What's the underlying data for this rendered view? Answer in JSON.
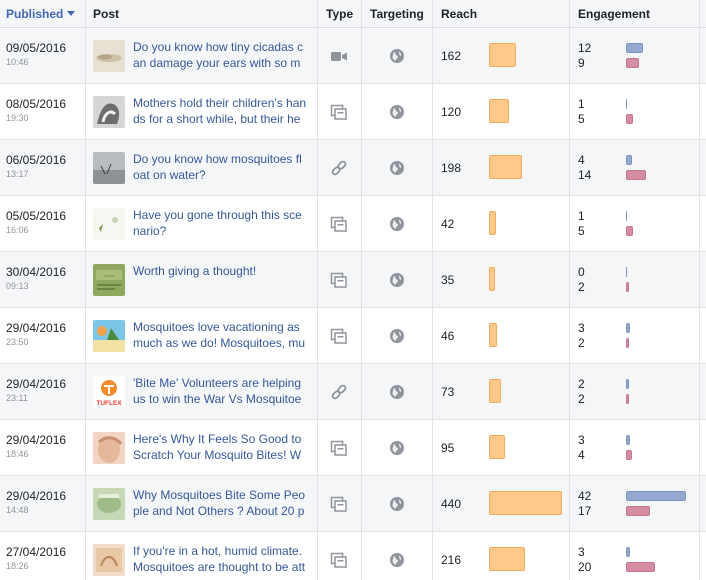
{
  "header": {
    "published": "Published",
    "post": "Post",
    "type": "Type",
    "targeting": "Targeting",
    "reach": "Reach",
    "engagement": "Engagement"
  },
  "colors": {
    "reach_bar": "#ffc98b",
    "engagement_clicks": "#97a8d1",
    "engagement_reactions": "#d58da1",
    "link": "#365899",
    "sorted_header": "#4267b2"
  },
  "rows": [
    {
      "date": "09/05/2016",
      "time": "10:46",
      "post": "Do you know how tiny cicadas can damage your ears with so mu",
      "type_icon": "video-icon",
      "targeting_icon": "globe-icon",
      "reach": "162",
      "eng_top": "12",
      "eng_bottom": "9",
      "thumb": "cicada"
    },
    {
      "date": "08/05/2016",
      "time": "19:30",
      "post": "Mothers hold their children's hands for a short while, but their hea",
      "type_icon": "status-icon",
      "targeting_icon": "globe-icon",
      "reach": "120",
      "eng_top": "1",
      "eng_bottom": "5",
      "thumb": "hands"
    },
    {
      "date": "06/05/2016",
      "time": "13:17",
      "post": "Do you know how mosquitoes float on water?",
      "type_icon": "link-icon",
      "targeting_icon": "globe-icon",
      "reach": "198",
      "eng_top": "4",
      "eng_bottom": "14",
      "thumb": "water"
    },
    {
      "date": "05/05/2016",
      "time": "16:06",
      "post": "Have you gone through this scenario?",
      "type_icon": "status-icon",
      "targeting_icon": "globe-icon",
      "reach": "42",
      "eng_top": "1",
      "eng_bottom": "5",
      "thumb": "scenario"
    },
    {
      "date": "30/04/2016",
      "time": "09:13",
      "post": "Worth giving a thought!",
      "type_icon": "status-icon",
      "targeting_icon": "globe-icon",
      "reach": "35",
      "eng_top": "0",
      "eng_bottom": "2",
      "thumb": "thought"
    },
    {
      "date": "29/04/2016",
      "time": "23:50",
      "post": "Mosquitoes love vacationing as much as we do! Mosquitoes, mu",
      "type_icon": "status-icon",
      "targeting_icon": "globe-icon",
      "reach": "46",
      "eng_top": "3",
      "eng_bottom": "2",
      "thumb": "vacation"
    },
    {
      "date": "29/04/2016",
      "time": "23:11",
      "post": "'Bite Me' Volunteers are helping us to win the War Vs Mosquitoes",
      "type_icon": "link-icon",
      "targeting_icon": "globe-icon",
      "reach": "73",
      "eng_top": "2",
      "eng_bottom": "2",
      "thumb": "tuflex",
      "thumb_label": "TUFLEX"
    },
    {
      "date": "29/04/2016",
      "time": "18:46",
      "post": "Here's Why It Feels So Good to Scratch Your Mosquito Bites! We",
      "type_icon": "status-icon",
      "targeting_icon": "globe-icon",
      "reach": "95",
      "eng_top": "3",
      "eng_bottom": "4",
      "thumb": "scratch"
    },
    {
      "date": "29/04/2016",
      "time": "14:48",
      "post": "Why Mosquitoes Bite Some People and Not Others ? About 20 p",
      "type_icon": "status-icon",
      "targeting_icon": "globe-icon",
      "reach": "440",
      "eng_top": "42",
      "eng_bottom": "17",
      "thumb": "bite"
    },
    {
      "date": "27/04/2016",
      "time": "18:26",
      "post": "If you're in a hot, humid climate. Mosquitoes are thought to be att",
      "type_icon": "status-icon",
      "targeting_icon": "globe-icon",
      "reach": "216",
      "eng_top": "3",
      "eng_bottom": "20",
      "thumb": "humid"
    }
  ]
}
